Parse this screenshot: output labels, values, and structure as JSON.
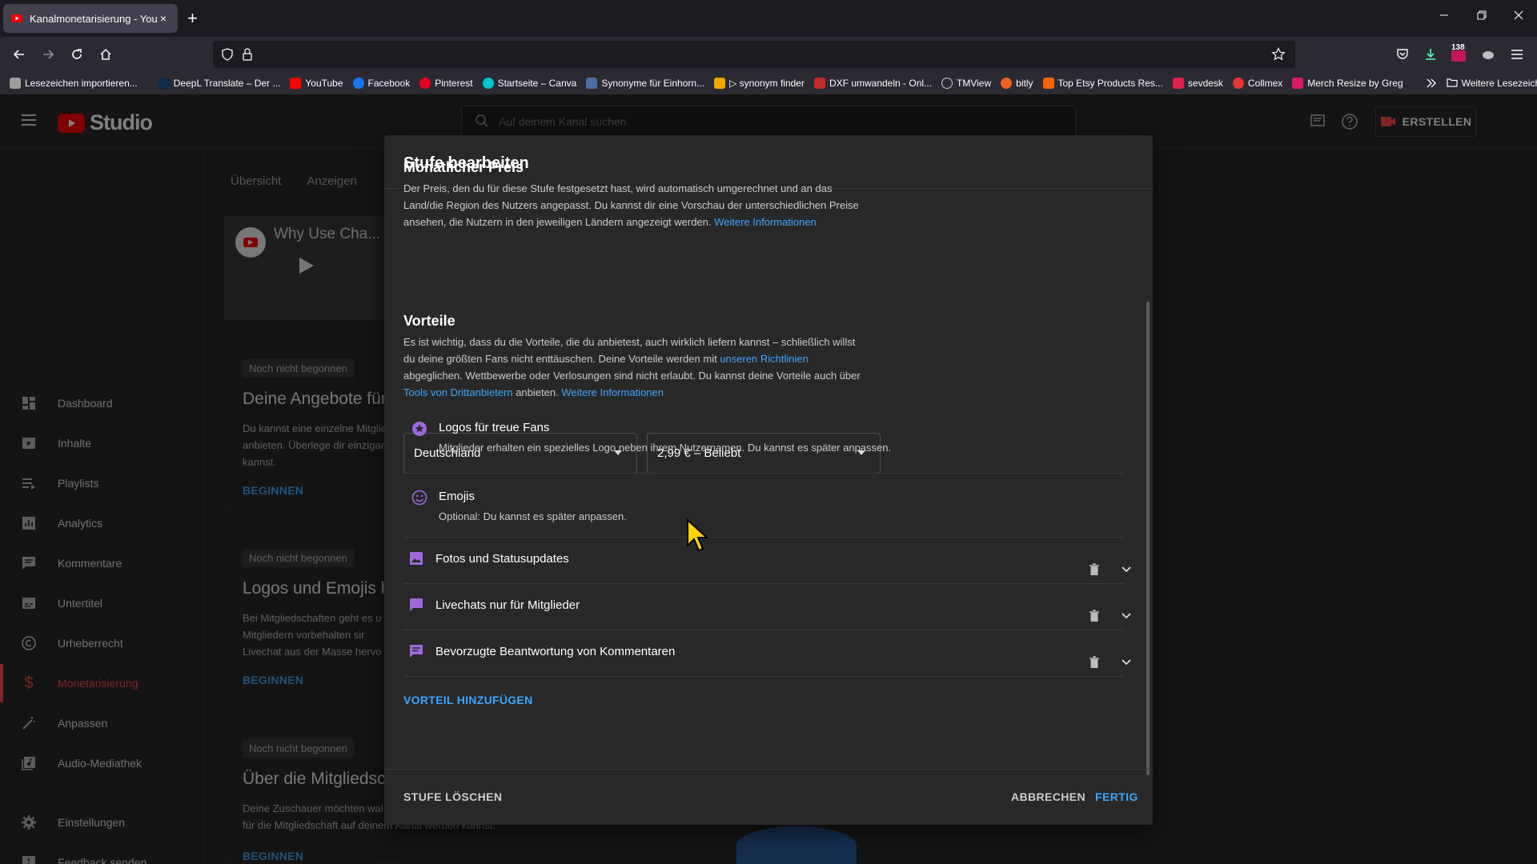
{
  "browser": {
    "tab_title": "Kanalmonetarisierung - YouTube",
    "new_tab": "+",
    "close_tab": "×",
    "download_badge": "138"
  },
  "bookmarks": [
    {
      "label": "Lesezeichen importieren...",
      "color": "#9e9e9e"
    },
    {
      "label": "DeepL Translate – Der ...",
      "color": "#0f2b46"
    },
    {
      "label": "YouTube",
      "color": "#ff0000"
    },
    {
      "label": "Facebook",
      "color": "#1877f2"
    },
    {
      "label": "Pinterest",
      "color": "#e60023"
    },
    {
      "label": "Startseite – Canva",
      "color": "#00c4cc"
    },
    {
      "label": "Synonyme für Einhorn...",
      "color": "#4a6fa5"
    },
    {
      "label": "▷ synonym finder",
      "color": "#f0a500"
    },
    {
      "label": "DXF umwandeln - Onl...",
      "color": "#c62828"
    },
    {
      "label": "TMView",
      "color": "#8d8d8d"
    },
    {
      "label": "bitly",
      "color": "#ee6123"
    },
    {
      "label": "Top Etsy Products Res...",
      "color": "#f56400"
    },
    {
      "label": "sevdesk",
      "color": "#e0204a"
    },
    {
      "label": "Collmex",
      "color": "#e53935"
    },
    {
      "label": "Merch Resize by Greg",
      "color": "#d81b60"
    }
  ],
  "more_bookmarks": "Weitere Lesezeichen",
  "studio": {
    "logo_text": "Studio",
    "search_placeholder": "Auf deinem Kanal suchen",
    "create_label": "ERSTELLEN"
  },
  "sidebar": {
    "items": [
      {
        "label": "Dashboard"
      },
      {
        "label": "Inhalte"
      },
      {
        "label": "Playlists"
      },
      {
        "label": "Analytics"
      },
      {
        "label": "Kommentare"
      },
      {
        "label": "Untertitel"
      },
      {
        "label": "Urheberrecht"
      },
      {
        "label": "Monetarisierung"
      },
      {
        "label": "Anpassen"
      },
      {
        "label": "Audio-Mediathek"
      }
    ],
    "bottom": [
      {
        "label": "Einstellungen"
      },
      {
        "label": "Feedback senden"
      }
    ]
  },
  "content": {
    "tabs": [
      "Übersicht",
      "Anzeigen"
    ],
    "video_title": "Why Use Cha...",
    "cards": [
      {
        "badge": "Noch nicht begonnen",
        "title": "Deine Angebote für",
        "text": "Du kannst eine einzelne Mitglie anbieten. Überlege dir einzigar kannst.",
        "link": "BEGINNEN"
      },
      {
        "badge": "Noch nicht begonnen",
        "title": "Logos und Emojis h",
        "text": "Bei Mitgliedschaften geht es u die Mitgliedern vorbehalten sir Livechat aus der Masse hervo",
        "link": "BEGINNEN"
      },
      {
        "badge": "Noch nicht begonnen",
        "title": "Über die Mitgliedsc",
        "text": "Deine Zuschauer möchten wal Kanalmitgliedschaft ist und we an, wie du für die Mitgliedschaft auf deinem Kanal werben kannst.",
        "link": "BEGINNEN"
      }
    ]
  },
  "dialog": {
    "title": "Stufe bearbeiten",
    "price": {
      "heading": "Monatlicher Preis",
      "text": "Der Preis, den du für diese Stufe festgesetzt hast, wird automatisch umgerechnet und an das Land/die Region des Nutzers angepasst. Du kannst dir eine Vorschau der unterschiedlichen Preise ansehen, die Nutzern in den jeweiligen Ländern angezeigt werden.",
      "link": "Weitere Informationen",
      "country": "Deutschland",
      "price_value": "2,99 € – Beliebt"
    },
    "perks": {
      "heading": "Vorteile",
      "text_1": "Es ist wichtig, dass du die Vorteile, die du anbietest, auch wirklich liefern kannst – schließlich willst du deine größten Fans nicht enttäuschen. Deine Vorteile werden mit",
      "link_1": "unseren Richtlinien",
      "text_2": "abgeglichen. Wettbewerbe oder Verlosungen sind nicht erlaubt. Du kannst deine Vorteile auch über",
      "link_2": "Tools von Drittanbietern",
      "text_3": "anbieten.",
      "link_3": "Weitere Informationen",
      "items": [
        {
          "title": "Logos für treue Fans",
          "desc": "Mitglieder erhalten ein spezielles Logo neben ihrem Nutzernamen. Du kannst es später anpassen."
        },
        {
          "title": "Emojis",
          "desc": "Optional: Du kannst es später anpassen."
        },
        {
          "title": "Fotos und Statusupdates"
        },
        {
          "title": "Livechats nur für Mitglieder"
        },
        {
          "title": "Bevorzugte Beantwortung von Kommentaren"
        }
      ],
      "add_label": "VORTEIL HINZUFÜGEN"
    },
    "footer": {
      "delete_label": "STUFE LÖSCHEN",
      "cancel_label": "ABBRECHEN",
      "done_label": "FERTIG"
    }
  },
  "colors": {
    "accent_blue": "#3ea6ff",
    "perk_purple": "#9c6ade",
    "brand_red": "#ff0000"
  }
}
